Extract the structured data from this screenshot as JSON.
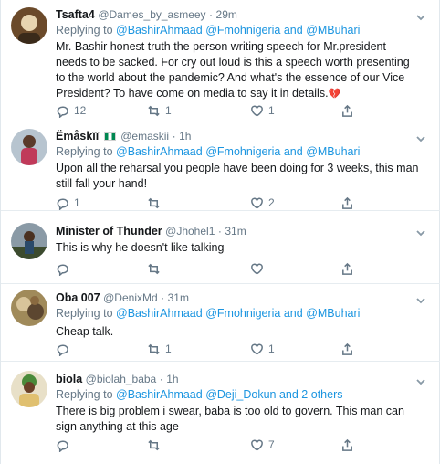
{
  "tweets": [
    {
      "name": "Tsafta4",
      "handle": "@Dames_by_asmeey",
      "time": "29m",
      "replying_prefix": "Replying to",
      "mentions": [
        "@BashirAhmaad",
        "@Fmohnigeria and",
        "@MBuhari"
      ],
      "text": "Mr. Bashir honest truth the person writing speech for Mr.president needs to be sacked. For cry out loud is this a speech worth presenting to the world about the pandemic? And what's the essence of our Vice President? To have come on media to say it in details.",
      "emoji": "broken-heart",
      "reply_count": "12",
      "retweet_count": "1",
      "like_count": "1",
      "avatar_colors": [
        "#6b4a2a",
        "#e8d5b0"
      ]
    },
    {
      "name": "Ëmåskïï",
      "handle": "@emaskii",
      "time": "1h",
      "replying_prefix": "Replying to",
      "mentions": [
        "@BashirAhmaad",
        "@Fmohnigeria and",
        "@MBuhari"
      ],
      "text": "Upon all the reharsal you people have been doing for 3 weeks, this man still fall your hand!",
      "reply_count": "1",
      "retweet_count": "",
      "like_count": "2",
      "avatar_colors": [
        "#b7c4cf",
        "#c03a5a"
      ]
    },
    {
      "name": "Minister of Thunder",
      "handle": "@Jhohel1",
      "time": "31m",
      "text": "This is why he doesn't like talking",
      "reply_count": "",
      "retweet_count": "",
      "like_count": "",
      "avatar_colors": [
        "#8a9aa6",
        "#3c4b2e"
      ]
    },
    {
      "name": "Oba 007",
      "handle": "@DenixMd",
      "time": "31m",
      "replying_prefix": "Replying to",
      "mentions": [
        "@BashirAhmaad",
        "@Fmohnigeria and",
        "@MBuhari"
      ],
      "text": "Cheap talk.",
      "reply_count": "",
      "retweet_count": "1",
      "like_count": "1",
      "avatar_colors": [
        "#a08a5a",
        "#5c4630"
      ]
    },
    {
      "name": "biola",
      "handle": "@biolah_baba",
      "time": "1h",
      "replying_prefix": "Replying to",
      "mentions": [
        "@BashirAhmaad",
        "@Deji_Dokun and 2 others"
      ],
      "text": "There is big problem i swear, baba is too old to govern. This man can sign anything at this age",
      "reply_count": "",
      "retweet_count": "",
      "like_count": "7",
      "avatar_colors": [
        "#4a8a3a",
        "#e0c070"
      ]
    }
  ],
  "colors": {
    "link": "#1b95e0",
    "muted": "#657786",
    "text": "#14171a",
    "border": "#e6ecf0"
  },
  "icons": {
    "reply": "reply-icon",
    "retweet": "retweet-icon",
    "like": "heart-icon",
    "share": "share-icon",
    "more": "chevron-down-icon"
  }
}
